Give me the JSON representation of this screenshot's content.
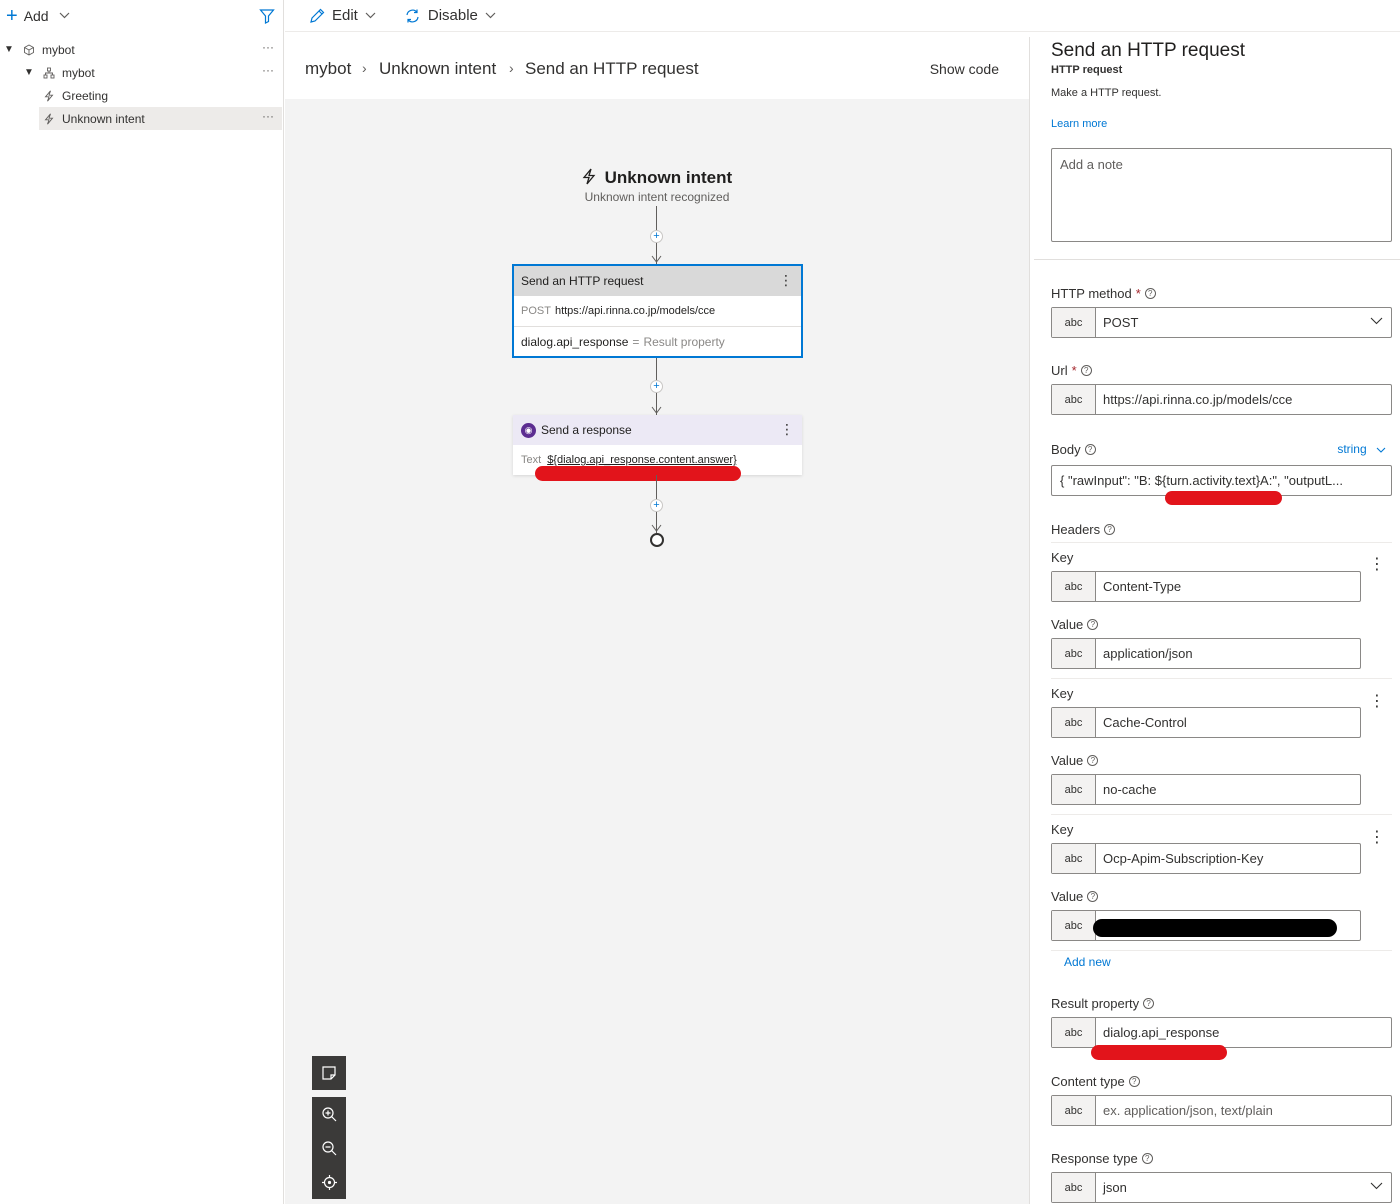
{
  "left": {
    "add_label": "Add",
    "tree": [
      {
        "label": "mybot",
        "more": "···"
      },
      {
        "label": "mybot",
        "more": "···"
      },
      {
        "label": "Greeting"
      },
      {
        "label": "Unknown intent",
        "more": "···"
      }
    ]
  },
  "toolbar": {
    "edit_label": "Edit",
    "disable_label": "Disable"
  },
  "breadcrumb": {
    "items": [
      "mybot",
      "Unknown intent",
      "Send an HTTP request"
    ],
    "sep": "›",
    "show_code": "Show code"
  },
  "canvas": {
    "trigger_title": "Unknown intent",
    "trigger_subtitle": "Unknown intent recognized",
    "http_node": {
      "title": "Send an HTTP request",
      "method": "POST",
      "url": "https://api.rinna.co.jp/models/cce",
      "result_var": "dialog.api_response",
      "equals": "=",
      "result_label": "Result property"
    },
    "response_node": {
      "title": "Send a response",
      "text_label": "Text",
      "text_value": "${dialog.api_response.content.answer}"
    },
    "kebab": "⋮",
    "plus": "+"
  },
  "panel": {
    "title": "Send an HTTP request",
    "subtitle": "HTTP request",
    "description": "Make a HTTP request.",
    "learn_more": "Learn more",
    "note_placeholder": "Add a note",
    "abc": "abc",
    "http_method_label": "HTTP method",
    "http_method_value": "POST",
    "url_label": "Url",
    "url_value": "https://api.rinna.co.jp/models/cce",
    "body_label": "Body",
    "body_type": "string",
    "body_value": "{     \"rawInput\": \"B: ${turn.activity.text}A:\",     \"outputL...",
    "headers_label": "Headers",
    "key_label": "Key",
    "value_label": "Value",
    "headers": [
      {
        "key": "Content-Type",
        "value": "application/json"
      },
      {
        "key": "Cache-Control",
        "value": "no-cache"
      },
      {
        "key": "Ocp-Apim-Subscription-Key",
        "value": ""
      }
    ],
    "add_new": "Add new",
    "result_label": "Result property",
    "result_value": "dialog.api_response",
    "content_type_label": "Content type",
    "content_type_placeholder": "ex. application/json, text/plain",
    "response_type_label": "Response type",
    "response_type_value": "json"
  },
  "colors": {
    "accent": "#0078d4",
    "redaction_red": "#e2141b",
    "redaction_black": "#000000",
    "bot_purple": "#5c2d91"
  },
  "icons": [
    "plus-icon",
    "filter-icon",
    "pencil-icon",
    "refresh-icon",
    "bot-icon",
    "dialog-icon",
    "lightning-icon",
    "zoom-in-icon",
    "zoom-out-icon",
    "locate-icon",
    "minimap-icon",
    "chevron-down-icon",
    "info-icon"
  ]
}
